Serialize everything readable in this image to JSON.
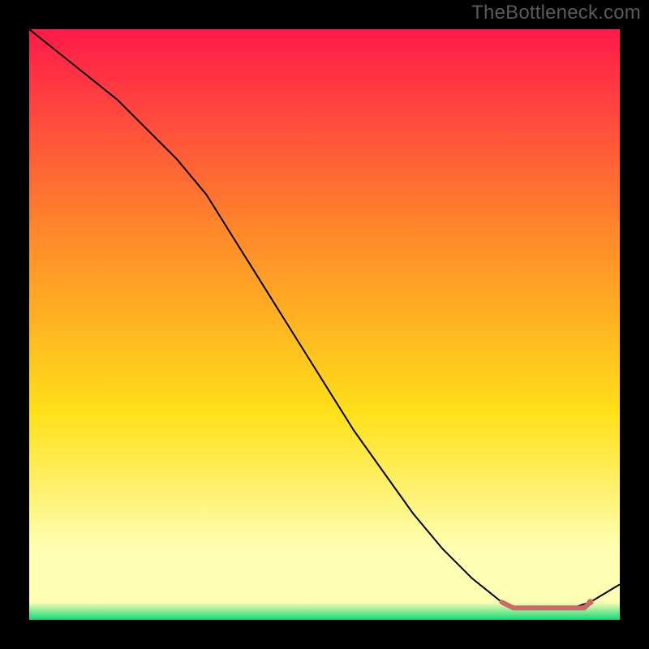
{
  "watermark": "TheBottleneck.com",
  "colors": {
    "gradient_top": "#ff1a4a",
    "gradient_orange": "#ff8a2a",
    "gradient_yellow": "#ffe019",
    "gradient_paleyellow": "#ffffb3",
    "gradient_green": "#10d97a",
    "line_main": "#000000",
    "line_flat": "#d06868",
    "frame": "#000000"
  },
  "chart_data": {
    "type": "line",
    "title": "",
    "xlabel": "",
    "ylabel": "",
    "xlim": [
      0,
      100
    ],
    "ylim": [
      0,
      100
    ],
    "series": [
      {
        "name": "main-curve",
        "x": [
          0,
          5,
          10,
          15,
          20,
          25,
          30,
          35,
          40,
          45,
          50,
          55,
          60,
          65,
          70,
          75,
          80,
          82,
          88,
          92,
          95,
          100
        ],
        "y": [
          100,
          96,
          92,
          88,
          83,
          78,
          72,
          64,
          56,
          48,
          40,
          32,
          25,
          18,
          12,
          7,
          3,
          2,
          2,
          2,
          3,
          6
        ]
      },
      {
        "name": "highlight-flat",
        "x": [
          80,
          82,
          84,
          86,
          88,
          90,
          92,
          94,
          95
        ],
        "y": [
          3,
          2,
          2,
          2,
          2,
          2,
          2,
          2,
          3
        ]
      }
    ]
  }
}
